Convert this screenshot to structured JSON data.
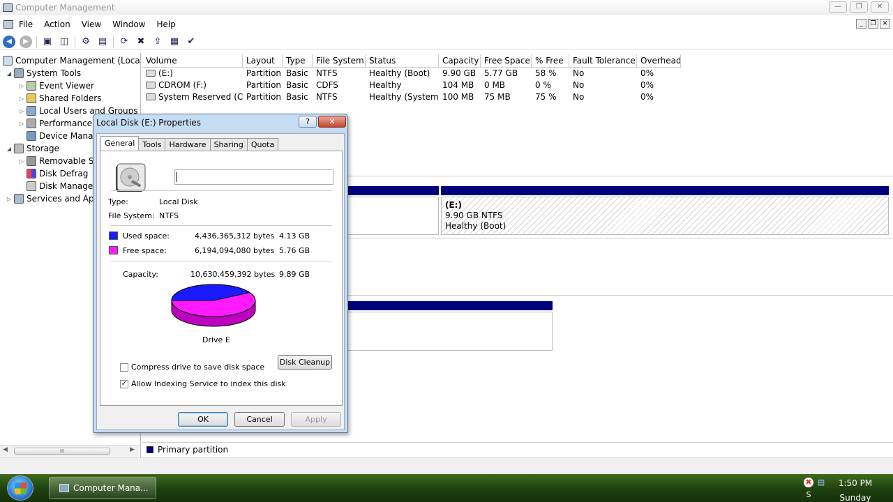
{
  "window": {
    "title": "Computer Management"
  },
  "menu": {
    "items": [
      "File",
      "Action",
      "View",
      "Window",
      "Help"
    ]
  },
  "window_controls": {
    "minimize": "—",
    "restore": "❐",
    "close": "✕"
  },
  "mdi_controls": {
    "minimize": "_",
    "restore": "❐",
    "close": "✕"
  },
  "toolbar": {
    "icons": [
      "back-arrow-icon",
      "forward-arrow-icon",
      "up-folder-icon",
      "show-hide-tree-icon",
      "properties-icon",
      "export-list-icon",
      "refresh-icon",
      "delete-icon",
      "help-icon",
      "console-icon",
      "check-icon"
    ]
  },
  "tree": {
    "root": "Computer Management (Local)",
    "system_tools": "System Tools",
    "event_viewer": "Event Viewer",
    "shared_folders": "Shared Folders",
    "local_users": "Local Users and Groups",
    "performance": "Performance",
    "device_manager": "Device Mana",
    "storage": "Storage",
    "removable": "Removable S",
    "disk_defrag": "Disk Defrag",
    "disk_management": "Disk Manage",
    "services": "Services and Ap",
    "scroll_grip": "III",
    "scroll_left": "◀",
    "scroll_right": "▶",
    "expander_open": "◢",
    "expander_closed": "▷"
  },
  "volume_list": {
    "columns": [
      "Volume",
      "Layout",
      "Type",
      "File System",
      "Status",
      "Capacity",
      "Free Space",
      "% Free",
      "Fault Tolerance",
      "Overhead"
    ],
    "rows": [
      [
        "(E:)",
        "Partition",
        "Basic",
        "NTFS",
        "Healthy (Boot)",
        "9.90 GB",
        "5.77 GB",
        "58 %",
        "No",
        "0%"
      ],
      [
        "CDROM (F:)",
        "Partition",
        "Basic",
        "CDFS",
        "Healthy",
        "104 MB",
        "0 MB",
        "0 %",
        "No",
        "0%"
      ],
      [
        "System Reserved (C:)",
        "Partition",
        "Basic",
        "NTFS",
        "Healthy (System)",
        "100 MB",
        "75 MB",
        "75 %",
        "No",
        "0%"
      ]
    ]
  },
  "disk_graph": {
    "partition_label": "(E:)",
    "partition_size": "9.90 GB NTFS",
    "partition_status": "Healthy (Boot)"
  },
  "legend": {
    "primary_partition": "Primary partition"
  },
  "dialog": {
    "title": "Local Disk (E:) Properties",
    "help_glyph": "?",
    "close_glyph": "✕",
    "tabs": [
      "General",
      "Tools",
      "Hardware",
      "Sharing",
      "Quota"
    ],
    "volume_name_value": "",
    "type_label": "Type:",
    "type_value": "Local Disk",
    "fs_label": "File System:",
    "fs_value": "NTFS",
    "used_label": "Used space:",
    "used_bytes": "4,436,365,312 bytes",
    "used_gb": "4.13 GB",
    "free_label": "Free space:",
    "free_bytes": "6,194,094,080 bytes",
    "free_gb": "5.76 GB",
    "capacity_label": "Capacity:",
    "capacity_bytes": "10,630,459,392 bytes",
    "capacity_gb": "9.89 GB",
    "drive_label": "Drive E",
    "used_fraction": 0.417,
    "used_color": "#1a1aff",
    "free_color": "#ff1aff",
    "disk_cleanup": "Disk Cleanup",
    "compress_label": "Compress drive to save disk space",
    "compress_checked": false,
    "indexing_label": "Allow Indexing Service to index this disk",
    "indexing_checked": true,
    "check_glyph": "✓",
    "ok": "OK",
    "cancel": "Cancel",
    "apply": "Apply"
  },
  "taskbar": {
    "task_label": "Computer Mana...",
    "time": "1:50 PM",
    "day": "Sunday"
  },
  "colors": {
    "partition_bar": "#00007c",
    "taskbar": "#1e4010"
  }
}
